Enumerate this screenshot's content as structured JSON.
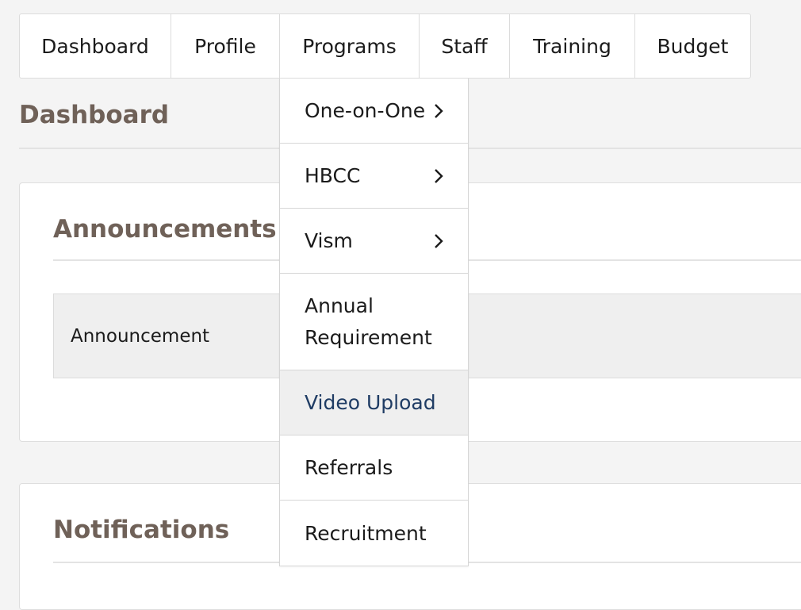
{
  "nav": {
    "items": [
      {
        "label": "Dashboard"
      },
      {
        "label": "Profile"
      },
      {
        "label": "Programs"
      },
      {
        "label": "Staff"
      },
      {
        "label": "Training"
      },
      {
        "label": "Budget"
      }
    ]
  },
  "page": {
    "title": "Dashboard"
  },
  "programs_menu": {
    "items": [
      {
        "label": "One-on-One",
        "icon": "chevron-right-icon"
      },
      {
        "label": "HBCC",
        "icon": "chevron-right-icon"
      },
      {
        "label": "Vism",
        "icon": "chevron-right-icon"
      },
      {
        "label": "Annual Requirement"
      },
      {
        "label": "Video Upload"
      },
      {
        "label": "Referrals"
      },
      {
        "label": "Recruitment"
      }
    ],
    "active_color": "#1f3c64"
  },
  "announcements": {
    "title": "Announcements",
    "columns": [
      "Announcement"
    ]
  },
  "notifications": {
    "title": "Notifications"
  },
  "colors": {
    "heading": "#6f6158",
    "background": "#f4f4f4",
    "active_item_bg": "#efefef"
  }
}
